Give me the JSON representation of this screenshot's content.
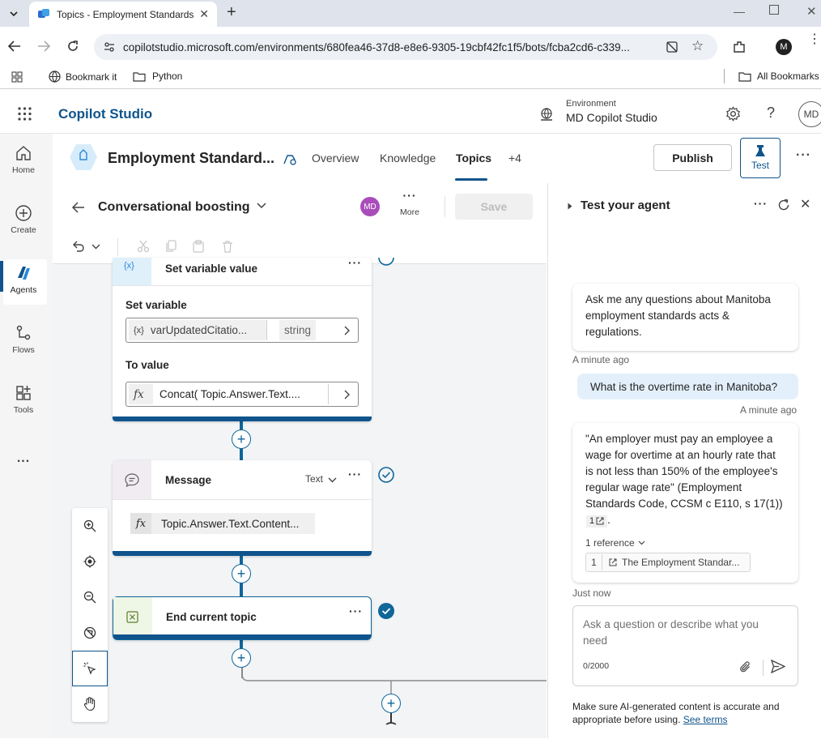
{
  "browser": {
    "tab_title": "Topics - Employment Standards",
    "url": "copilotstudio.microsoft.com/environments/680fea46-37d8-e8e6-9305-19cbf42fc1f5/bots/fcba2cd6-c339...",
    "profile_initial": "M",
    "bookmarks": [
      "Bookmark it",
      "Python"
    ],
    "all_bookmarks": "All Bookmarks"
  },
  "app": {
    "name": "Copilot Studio",
    "env_label": "Environment",
    "env_name": "MD Copilot Studio",
    "user_initials": "MD"
  },
  "leftnav": {
    "items": [
      {
        "label": "Home",
        "icon": "home-icon"
      },
      {
        "label": "Create",
        "icon": "plus-circle-icon"
      },
      {
        "label": "Agents",
        "icon": "copilot-icon"
      },
      {
        "label": "Flows",
        "icon": "flow-icon"
      },
      {
        "label": "Tools",
        "icon": "apps-add-icon"
      }
    ],
    "more": "..."
  },
  "agentbar": {
    "agent_name": "Employment Standard...",
    "tabs": [
      "Overview",
      "Knowledge",
      "Topics",
      "+4"
    ],
    "active_tab": "Topics",
    "publish": "Publish",
    "test": "Test"
  },
  "topic": {
    "name": "Conversational boosting",
    "owner_initials": "MD",
    "more": "More",
    "save": "Save"
  },
  "nodes": {
    "setvar": {
      "title": "Set variable value",
      "set_label": "Set variable",
      "var_icon": "{x}",
      "var_name": "varUpdatedCitatio...",
      "var_type": "string",
      "value_label": "To value",
      "fx": "fx",
      "value": "Concat( Topic.Answer.Text...."
    },
    "message": {
      "title": "Message",
      "type": "Text",
      "fx": "fx",
      "content": "Topic.Answer.Text.Content..."
    },
    "end": {
      "title": "End current topic"
    }
  },
  "test_panel": {
    "title": "Test your agent",
    "messages": [
      {
        "role": "bot",
        "text": "Ask me any questions about Manitoba employment standards acts & regulations.",
        "time": "A minute ago"
      },
      {
        "role": "user",
        "text": "What is the overtime rate in Manitoba?",
        "time": "A minute ago"
      },
      {
        "role": "bot",
        "text": "\"An employer must pay an employee a wage for overtime at an hourly rate that is not less than 150% of the employee's regular wage rate\" (Employment Standards Code, CCSM c E110, s 17(1))",
        "citation": "1",
        "references_label": "1 reference",
        "reference_num": "1",
        "reference_title": "The Employment Standar...",
        "time": "Just now"
      }
    ],
    "input_placeholder": "Ask a question or describe what you need",
    "char_count": "0/2000",
    "disclaimer": "Make sure AI-generated content is accurate and appropriate before using.",
    "see_terms": "See terms"
  },
  "colors": {
    "brand": "#0f548c",
    "accent_line": "#0f6699",
    "avatar": "#a94dbb"
  }
}
